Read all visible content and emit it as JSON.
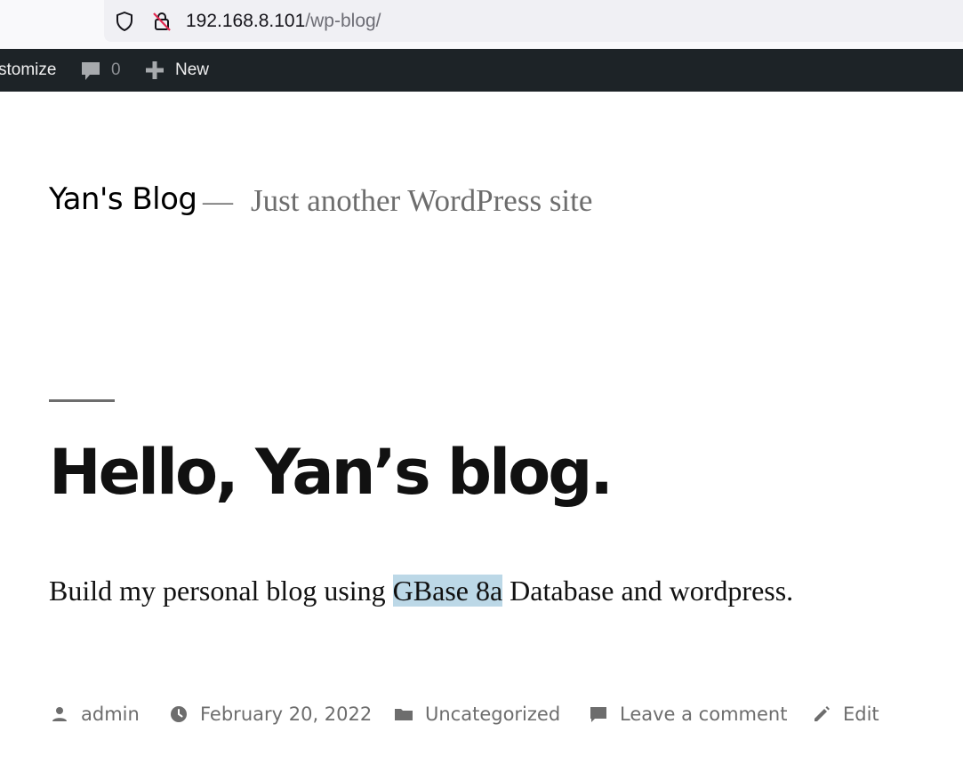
{
  "browser": {
    "url_host": "192.168.8.101",
    "url_path": "/wp-blog/",
    "icons": [
      "shield-icon",
      "insecure-lock-icon"
    ]
  },
  "admin_bar": {
    "customize_label": "stomize",
    "comments_count": "0",
    "new_label": "New",
    "background": "#1d2327"
  },
  "site": {
    "title": "Yan's Blog",
    "separator": "—",
    "description": "Just another WordPress site"
  },
  "post": {
    "title": "Hello, Yan’s blog.",
    "content_before": "Build my personal blog using ",
    "content_highlight": "GBase 8a",
    "content_after": " Database and wordpress.",
    "highlight_color": "#bcd8e7",
    "meta": {
      "author": "admin",
      "date": "February 20, 2022",
      "category": "Uncategorized",
      "comment_link": "Leave a comment",
      "edit_link": "Edit"
    }
  }
}
